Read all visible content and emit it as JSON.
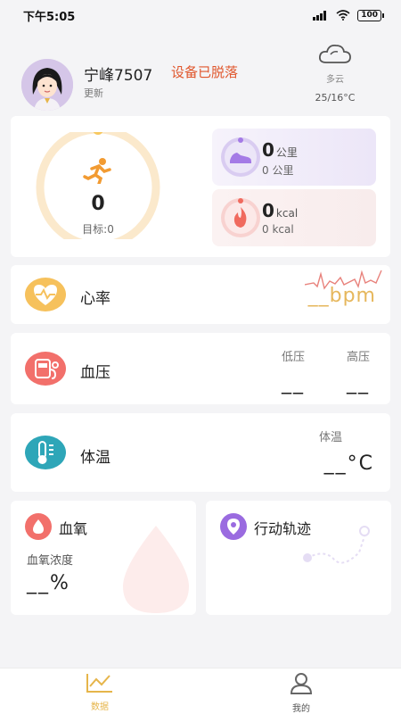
{
  "status_bar": {
    "time": "下午5:05",
    "battery": "100"
  },
  "header": {
    "username": "宁峰7507",
    "device_status": "设备已脱落",
    "update_label": "更新",
    "weather": {
      "icon": "cloud-icon",
      "condition": "多云",
      "temperature": "25/16°C"
    }
  },
  "activity": {
    "steps": "0",
    "goal_label": "目标:0",
    "distance": {
      "value": "0",
      "unit": "公里",
      "sub": "0 公里"
    },
    "calories": {
      "value": "0",
      "unit": "kcal",
      "sub": "0 kcal"
    }
  },
  "heart_rate": {
    "label": "心率",
    "value": "__bpm"
  },
  "blood_pressure": {
    "label": "血压",
    "low_label": "低压",
    "high_label": "高压",
    "low_value": "__",
    "high_value": "__"
  },
  "temperature": {
    "label": "体温",
    "sub_label": "体温",
    "value": "__°C"
  },
  "spo2": {
    "label": "血氧",
    "sub_label": "血氧浓度",
    "value": "__%"
  },
  "track": {
    "label": "行动轨迹"
  },
  "tabs": [
    {
      "label": "数据",
      "icon": "chart-icon",
      "active": true
    },
    {
      "label": "我的",
      "icon": "person-icon",
      "active": false
    }
  ],
  "colors": {
    "accent": "#e6b54a",
    "warning": "#e0562c",
    "heart": "#f2c25a",
    "bp": "#f2706b",
    "temp": "#2ea6b8",
    "spo2": "#f2706b",
    "track": "#9a6be0"
  }
}
